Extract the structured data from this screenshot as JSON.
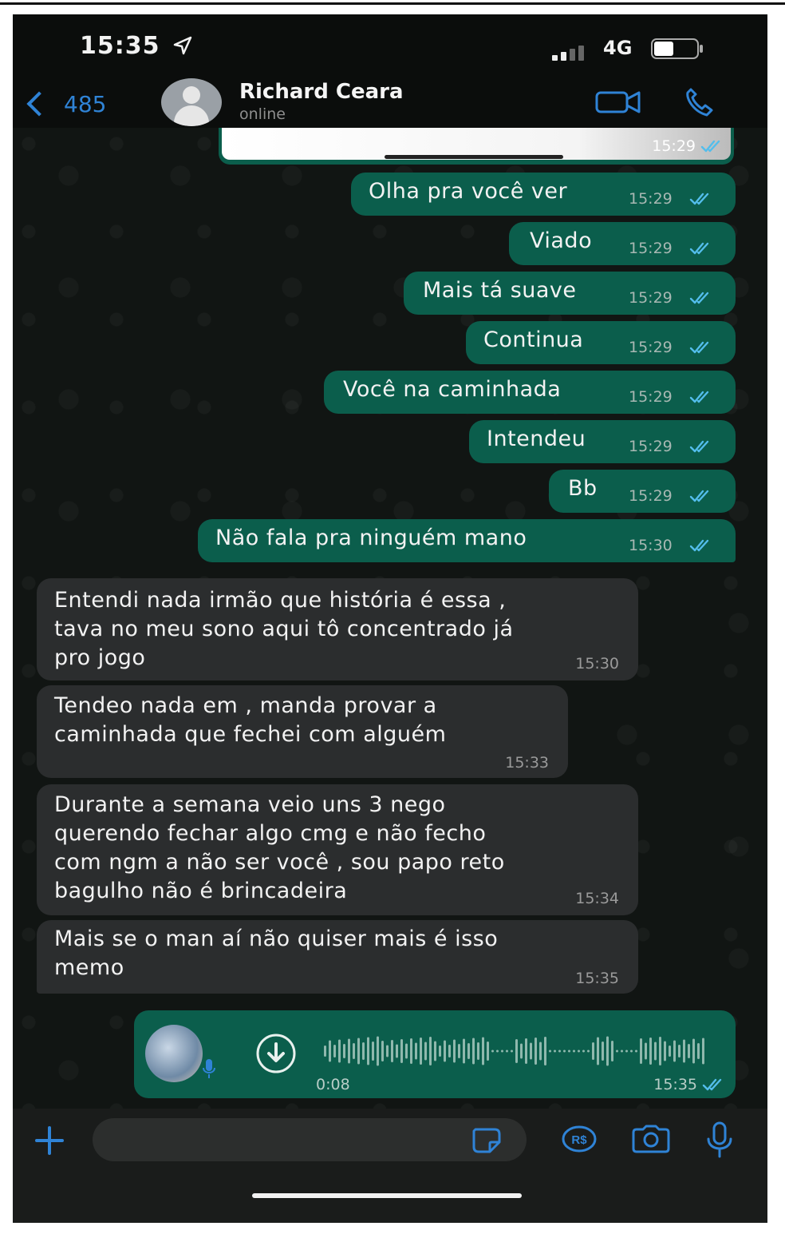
{
  "status_bar": {
    "time": "15:35",
    "network": "4G"
  },
  "header": {
    "back_count": "485",
    "contact_name": "Richard Ceara",
    "contact_status": "online"
  },
  "colors": {
    "outgoing_bubble": "#0b5e4c",
    "incoming_bubble": "#2b2d2e",
    "accent": "#2f83d6"
  },
  "messages": [
    {
      "dir": "out",
      "type": "image",
      "time": "15:29"
    },
    {
      "dir": "out",
      "text": "Olha pra você ver",
      "time": "15:29"
    },
    {
      "dir": "out",
      "text": "Viado",
      "time": "15:29"
    },
    {
      "dir": "out",
      "text": "Mais tá suave",
      "time": "15:29"
    },
    {
      "dir": "out",
      "text": "Continua",
      "time": "15:29"
    },
    {
      "dir": "out",
      "text": "Você na caminhada",
      "time": "15:29"
    },
    {
      "dir": "out",
      "text": "Intendeu",
      "time": "15:29"
    },
    {
      "dir": "out",
      "text": "Bb",
      "time": "15:29"
    },
    {
      "dir": "out",
      "text": "Não fala pra ninguém mano",
      "time": "15:30"
    },
    {
      "dir": "in",
      "lines": [
        "Entendi nada irmão que história é essa ,",
        "tava no meu sono aqui tô concentrado já",
        "pro jogo"
      ],
      "time": "15:30"
    },
    {
      "dir": "in",
      "lines": [
        "Tendeo nada em , manda provar a",
        "caminhada que fechei com alguém"
      ],
      "time": "15:33"
    },
    {
      "dir": "in",
      "lines": [
        "Durante a semana veio uns 3 nego",
        "querendo fechar algo cmg e não fecho",
        "com ngm a não ser você , sou papo reto",
        "bagulho não é brincadeira"
      ],
      "time": "15:34"
    },
    {
      "dir": "in",
      "lines": [
        "Mais se o man aí não quiser mais é isso",
        "memo"
      ],
      "time": "15:35"
    },
    {
      "dir": "out",
      "type": "voice",
      "duration": "0:08",
      "time": "15:35"
    }
  ],
  "icons": {
    "back": "chevron-left-icon",
    "location": "location-arrow-icon",
    "video": "video-camera-icon",
    "call": "phone-icon",
    "plus": "plus-icon",
    "sticker": "sticker-icon",
    "rs": "rs-icon",
    "camera": "camera-icon",
    "mic": "microphone-icon",
    "download": "download-icon"
  }
}
